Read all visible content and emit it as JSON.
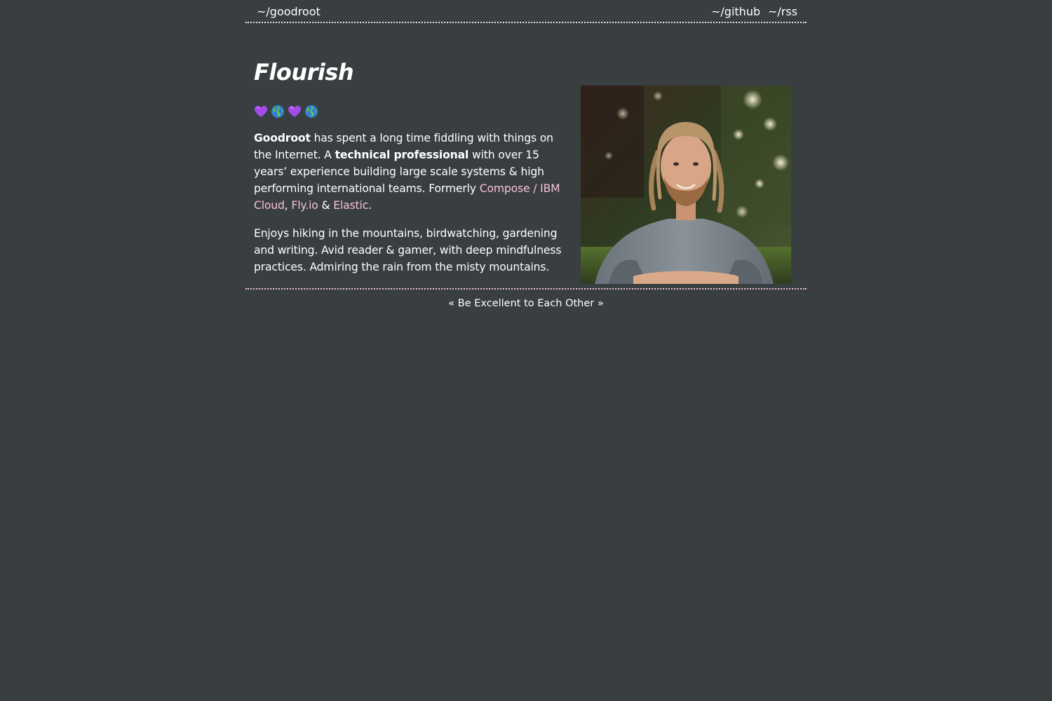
{
  "nav": {
    "home_label": "~/goodroot",
    "github_label": "~/github",
    "rss_label": "~/rss"
  },
  "main": {
    "title": "Flourish",
    "emojis": [
      "purple-heart-icon",
      "globe-icon",
      "purple-heart-icon",
      "globe-icon"
    ],
    "bio": {
      "name": "Goodroot",
      "text_1": " has spent a long time fiddling with things on the Internet. A ",
      "emphasis": "technical professional",
      "text_2": " with over 15 years’ experience building large scale systems & high performing international teams. Formerly ",
      "link_1": "Compose / IBM Cloud",
      "sep_1": ", ",
      "link_2": "Fly.io",
      "sep_2": " & ",
      "link_3": "Elastic",
      "end": "."
    },
    "hobbies": "Enjoys hiking in the mountains, birdwatching, gardening and writing. Avid reader & gamer, with deep mindfulness practices. Admiring the rain from the misty mountains."
  },
  "footer": {
    "motto": "« Be Excellent to Each Other »"
  },
  "colors": {
    "background": "#393e41",
    "link": "#f5c2d6",
    "text": "#ffffff"
  }
}
